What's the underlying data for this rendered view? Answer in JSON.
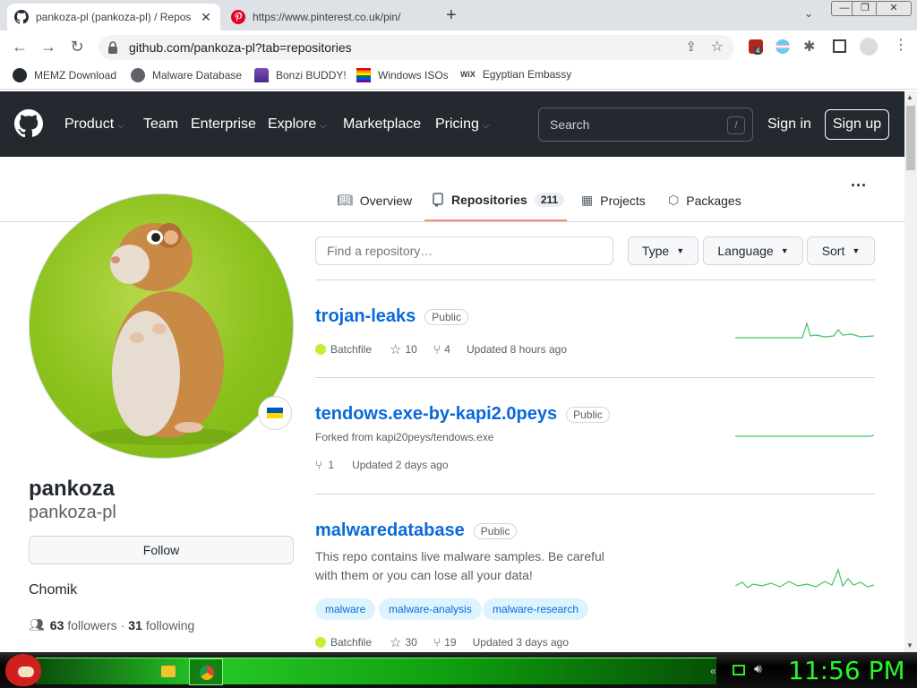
{
  "browser": {
    "tabs": [
      {
        "title": "pankoza-pl (pankoza-pl) / Repos",
        "icon": "github-icon",
        "active": true
      },
      {
        "title": "https://www.pinterest.co.uk/pin/",
        "icon": "pinterest-icon",
        "active": false
      }
    ],
    "new_tab": "+",
    "url": "github.com/pankoza-pl?tab=repositories",
    "extension_badge": "4",
    "bookmarks": [
      {
        "label": "MEMZ Download",
        "icon": "github-icon"
      },
      {
        "label": "Malware Database",
        "icon": "globe-icon"
      },
      {
        "label": "Bonzi BUDDY!",
        "icon": "bonzi-icon"
      },
      {
        "label": "Windows ISOs",
        "icon": "windows-flag-icon"
      },
      {
        "label": "Egyptian Embassy",
        "icon": "wix-icon"
      }
    ],
    "wix_label": "WiX"
  },
  "github": {
    "nav": [
      "Product",
      "Team",
      "Enterprise",
      "Explore",
      "Marketplace",
      "Pricing"
    ],
    "search_placeholder": "Search",
    "search_key": "/",
    "sign_in": "Sign in",
    "sign_up": "Sign up",
    "tabs": [
      "Overview",
      "Repositories",
      "Projects",
      "Packages"
    ],
    "repo_count": "211",
    "more": "···"
  },
  "profile": {
    "name": "pankoza",
    "login": "pankoza-pl",
    "follow": "Follow",
    "bio": "Chomik",
    "followers": "63",
    "followers_label": "followers",
    "sep": "·",
    "following": "31",
    "following_label": "following"
  },
  "filters": {
    "find_placeholder": "Find a repository…",
    "type": "Type",
    "language": "Language",
    "sort": "Sort"
  },
  "repos": [
    {
      "name": "trojan-leaks",
      "visibility": "Public",
      "language": "Batchfile",
      "stars": "10",
      "forks": "4",
      "updated": "Updated 8 hours ago"
    },
    {
      "name": "tendows.exe-by-kapi2.0peys",
      "visibility": "Public",
      "forked_from": "Forked from kapi20peys/tendows.exe",
      "forks": "1",
      "updated": "Updated 2 days ago"
    },
    {
      "name": "malwaredatabase",
      "visibility": "Public",
      "description": "This repo contains live malware samples. Be careful with them or you can lose all your data!",
      "topics": [
        "malware",
        "malware-analysis",
        "malware-research"
      ],
      "language": "Batchfile",
      "stars": "30",
      "forks": "19",
      "updated": "Updated 3 days ago"
    }
  ],
  "taskbar": {
    "clock": "11:56 PM",
    "colors": {
      "accent": "#27f527"
    }
  }
}
